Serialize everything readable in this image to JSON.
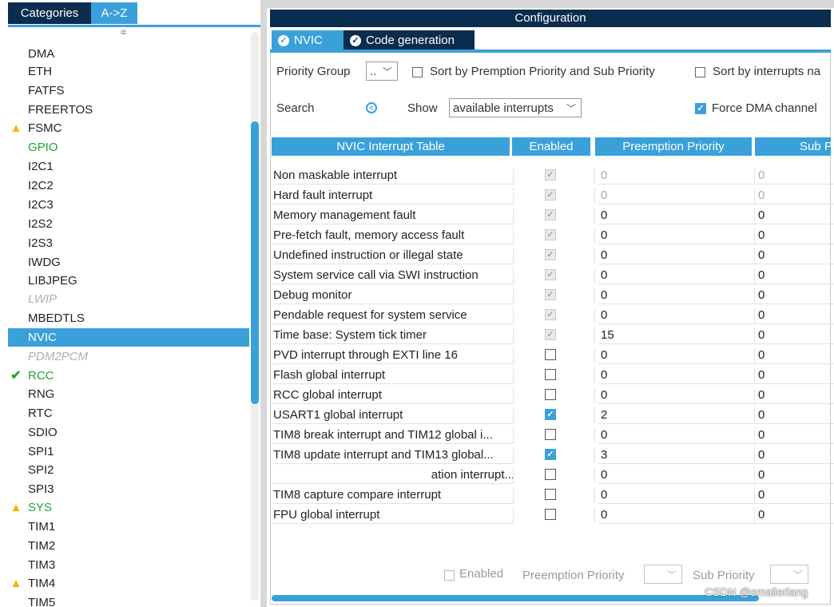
{
  "left_panel": {
    "tabs": {
      "categories": "Categories",
      "az": "A->Z"
    },
    "scroll_arrow": "≑",
    "items": [
      {
        "label": "DMA",
        "status": "none"
      },
      {
        "label": "ETH",
        "status": "none"
      },
      {
        "label": "FATFS",
        "status": "none"
      },
      {
        "label": "FREERTOS",
        "status": "none"
      },
      {
        "label": "FSMC",
        "status": "warning"
      },
      {
        "label": "GPIO",
        "status": "green"
      },
      {
        "label": "I2C1",
        "status": "none"
      },
      {
        "label": "I2C2",
        "status": "none"
      },
      {
        "label": "I2C3",
        "status": "none"
      },
      {
        "label": "I2S2",
        "status": "none"
      },
      {
        "label": "I2S3",
        "status": "none"
      },
      {
        "label": "IWDG",
        "status": "none"
      },
      {
        "label": "LIBJPEG",
        "status": "none"
      },
      {
        "label": "LWIP",
        "status": "disabled"
      },
      {
        "label": "MBEDTLS",
        "status": "none"
      },
      {
        "label": "NVIC",
        "status": "selected"
      },
      {
        "label": "PDM2PCM",
        "status": "disabled"
      },
      {
        "label": "RCC",
        "status": "ok"
      },
      {
        "label": "RNG",
        "status": "none"
      },
      {
        "label": "RTC",
        "status": "none"
      },
      {
        "label": "SDIO",
        "status": "none"
      },
      {
        "label": "SPI1",
        "status": "none"
      },
      {
        "label": "SPI2",
        "status": "none"
      },
      {
        "label": "SPI3",
        "status": "none"
      },
      {
        "label": "SYS",
        "status": "warning-green"
      },
      {
        "label": "TIM1",
        "status": "none"
      },
      {
        "label": "TIM2",
        "status": "none"
      },
      {
        "label": "TIM3",
        "status": "none"
      },
      {
        "label": "TIM4",
        "status": "warning"
      },
      {
        "label": "TIM5",
        "status": "none"
      }
    ]
  },
  "config": {
    "title": "Configuration",
    "tabs": {
      "nvic": "NVIC",
      "code": "Code generation"
    },
    "priority_group_label": "Priority Group",
    "priority_group_value": "..",
    "sort_premption": "Sort by Premption Priority and Sub Priority",
    "sort_interrupts": "Sort by interrupts na",
    "search_label": "Search",
    "show_label": "Show",
    "show_value": "available interrupts",
    "force_dma": "Force DMA channel",
    "table_headers": {
      "name": "NVIC Interrupt Table",
      "enabled": "Enabled",
      "preemption": "Preemption Priority",
      "sub": "Sub P"
    },
    "rows": [
      {
        "name": "Non maskable interrupt",
        "enabled": "locked",
        "pp": "0",
        "sp": "0",
        "grey": true
      },
      {
        "name": "Hard fault interrupt",
        "enabled": "locked",
        "pp": "0",
        "sp": "0",
        "grey": true
      },
      {
        "name": "Memory management fault",
        "enabled": "locked",
        "pp": "0",
        "sp": "0",
        "grey": false
      },
      {
        "name": "Pre-fetch fault, memory access fault",
        "enabled": "locked",
        "pp": "0",
        "sp": "0",
        "grey": false
      },
      {
        "name": "Undefined instruction or illegal state",
        "enabled": "locked",
        "pp": "0",
        "sp": "0",
        "grey": false
      },
      {
        "name": "System service call via SWI instruction",
        "enabled": "locked",
        "pp": "0",
        "sp": "0",
        "grey": false
      },
      {
        "name": "Debug monitor",
        "enabled": "locked",
        "pp": "0",
        "sp": "0",
        "grey": false
      },
      {
        "name": "Pendable request for system service",
        "enabled": "locked",
        "pp": "0",
        "sp": "0",
        "grey": false
      },
      {
        "name": "Time base: System tick timer",
        "enabled": "locked",
        "pp": "15",
        "sp": "0",
        "grey": false
      },
      {
        "name": "PVD interrupt through EXTI line 16",
        "enabled": "off",
        "pp": "0",
        "sp": "0",
        "grey": false
      },
      {
        "name": "Flash global interrupt",
        "enabled": "off",
        "pp": "0",
        "sp": "0",
        "grey": false
      },
      {
        "name": "RCC global interrupt",
        "enabled": "off",
        "pp": "0",
        "sp": "0",
        "grey": false
      },
      {
        "name": "USART1 global interrupt",
        "enabled": "on",
        "pp": "2",
        "sp": "0",
        "grey": false
      },
      {
        "name": "TIM8 break interrupt and TIM12 global i...",
        "enabled": "off",
        "pp": "0",
        "sp": "0",
        "grey": false
      },
      {
        "name": "TIM8 update interrupt and TIM13 global...",
        "enabled": "on",
        "pp": "3",
        "sp": "0",
        "grey": false
      },
      {
        "name": "ation interrupt...",
        "enabled": "off",
        "pp": "0",
        "sp": "0",
        "grey": false,
        "trunc": true
      },
      {
        "name": "TIM8 capture compare interrupt",
        "enabled": "off",
        "pp": "0",
        "sp": "0",
        "grey": false
      },
      {
        "name": "FPU global interrupt",
        "enabled": "off",
        "pp": "0",
        "sp": "0",
        "grey": false
      }
    ],
    "bottom": {
      "enabled": "Enabled",
      "preemption": "Preemption Priority",
      "sub": "Sub Priority"
    },
    "watermark": "CSDN @smallerlang"
  },
  "colors": {
    "accent": "#3aa0da",
    "navy": "#0a2c4e",
    "ok_green": "#22a33a",
    "warning": "#f2b600"
  }
}
